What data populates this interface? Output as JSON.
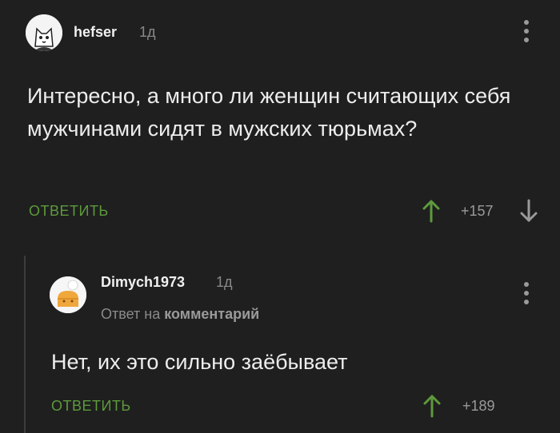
{
  "comments": [
    {
      "username": "hefser",
      "time": "1д",
      "text": "Интересно, а много ли женщин считающих себя мужчинами сидят в мужских тюрьмах?",
      "reply_label": "ОТВЕТИТЬ",
      "rating": "+157"
    },
    {
      "username": "Dimych1973",
      "time": "1д",
      "reply_to_prefix": "Ответ на",
      "reply_to_target": "комментарий",
      "text": "Нет, их это сильно заёбывает",
      "reply_label": "ОТВЕТИТЬ",
      "rating": "+189"
    }
  ],
  "colors": {
    "background": "#1f1f1f",
    "text": "#ededed",
    "muted": "#8a8a8a",
    "accent_green": "#5d9a3c"
  }
}
